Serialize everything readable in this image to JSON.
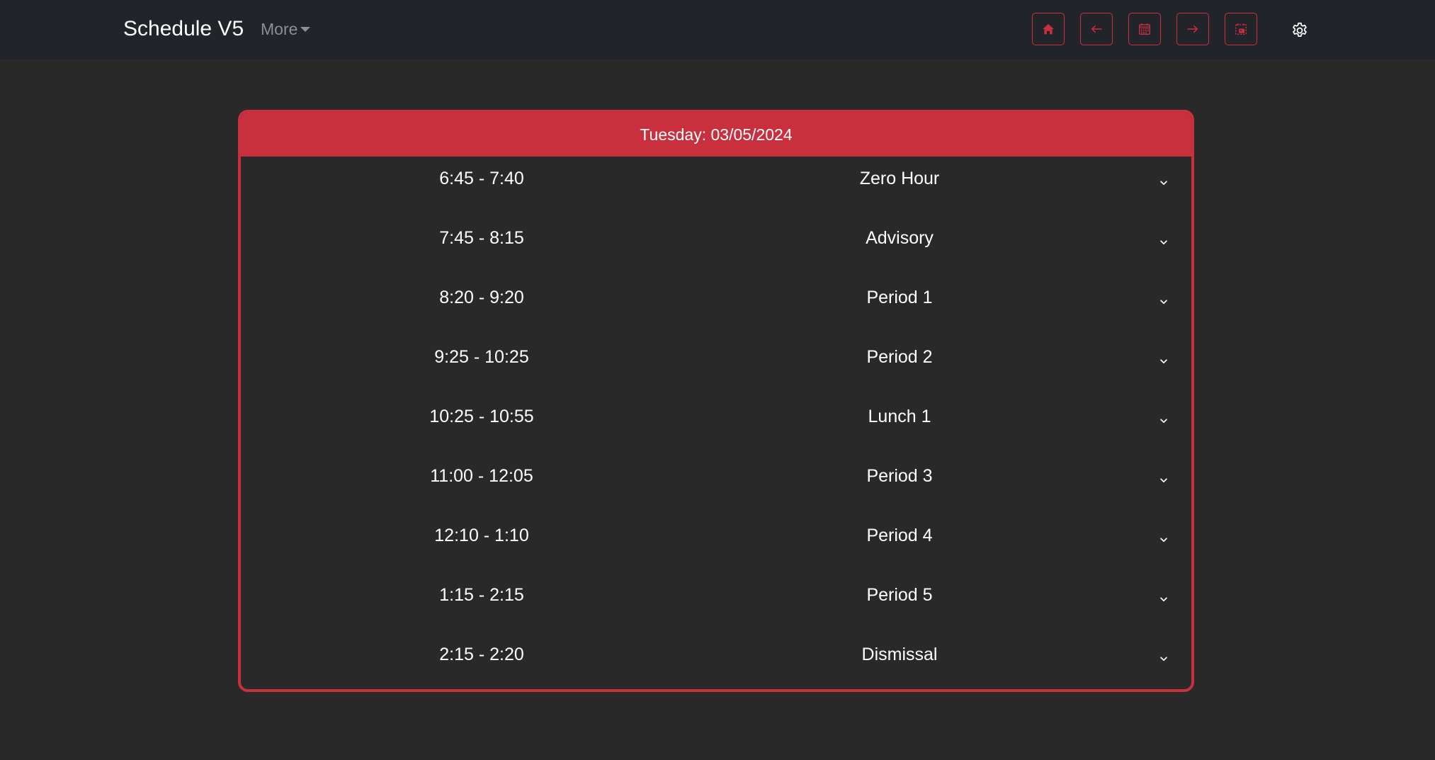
{
  "nav": {
    "brand": "Schedule V5",
    "more_label": "More",
    "buttons": [
      {
        "name": "home-button",
        "icon": "home-icon"
      },
      {
        "name": "previous-day-button",
        "icon": "arrow-left-icon"
      },
      {
        "name": "calendar-button",
        "icon": "calendar-icon"
      },
      {
        "name": "next-day-button",
        "icon": "arrow-right-icon"
      },
      {
        "name": "calendar-event-button",
        "icon": "calendar-event-icon"
      }
    ],
    "settings_icon": "gear-icon"
  },
  "schedule": {
    "date_label": "Tuesday: 03/05/2024",
    "periods": [
      {
        "time": "6:45 - 7:40",
        "name": "Zero Hour"
      },
      {
        "time": "7:45 - 8:15",
        "name": "Advisory"
      },
      {
        "time": "8:20 - 9:20",
        "name": "Period 1"
      },
      {
        "time": "9:25 - 10:25",
        "name": "Period 2"
      },
      {
        "time": "10:25 - 10:55",
        "name": "Lunch 1"
      },
      {
        "time": "11:00 - 12:05",
        "name": "Period 3"
      },
      {
        "time": "12:10 - 1:10",
        "name": "Period 4"
      },
      {
        "time": "1:15 - 2:15",
        "name": "Period 5"
      },
      {
        "time": "2:15 - 2:20",
        "name": "Dismissal"
      }
    ]
  },
  "colors": {
    "accent": "#c8303e",
    "background": "#292929",
    "navbar": "#212429",
    "muted_text": "#8c8f93"
  }
}
